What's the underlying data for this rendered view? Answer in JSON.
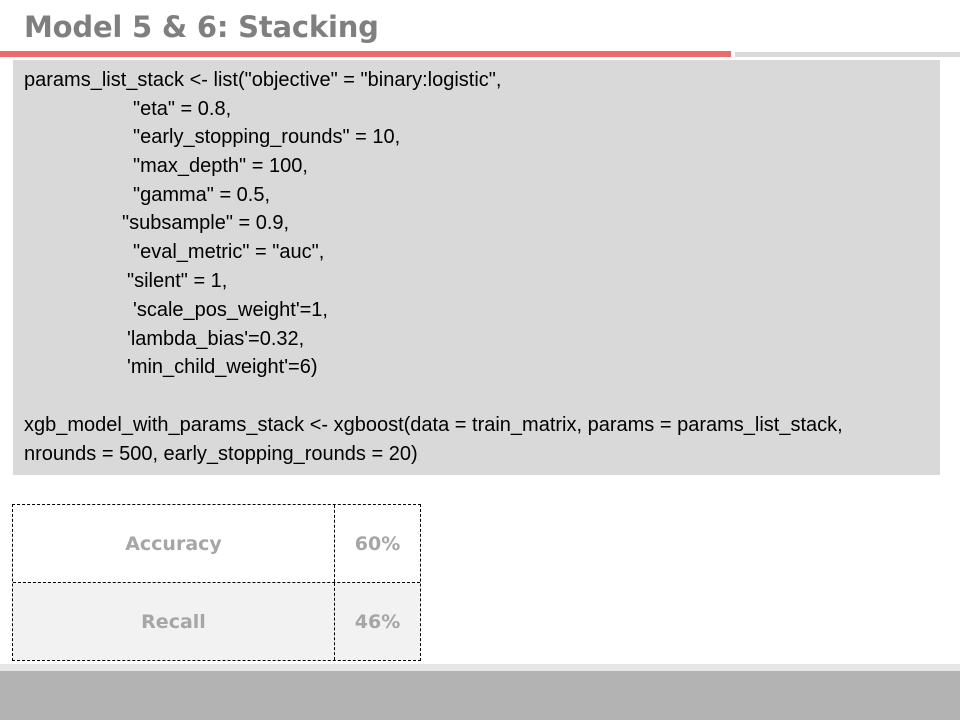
{
  "slide": {
    "title": "Model 5 & 6: Stacking",
    "colors": {
      "accent": "#e96b6d",
      "code_background": "#d9d9d9",
      "metric_text": "#a6a6a6",
      "footer": "#b3b3b3"
    }
  },
  "code": {
    "lines": [
      "params_list_stack <- list(\"objective\" = \"binary:logistic\",",
      "\"eta\" = 0.8,",
      "\"early_stopping_rounds\" = 10,",
      "\"max_depth\" = 100,",
      "\"gamma\" = 0.5,",
      "\"subsample\" = 0.9,",
      "\"eval_metric\" = \"auc\",",
      "\"silent\" = 1,",
      "'scale_pos_weight'=1,",
      "'lambda_bias'=0.32,",
      "'min_child_weight'=6)",
      "xgb_model_with_params_stack <- xgboost(data = train_matrix, params = params_list_stack,",
      "nrounds = 500, early_stopping_rounds = 20)"
    ]
  },
  "metrics": {
    "rows": [
      {
        "label": "Accuracy",
        "value": "60%"
      },
      {
        "label": "Recall",
        "value": "46%"
      }
    ]
  }
}
